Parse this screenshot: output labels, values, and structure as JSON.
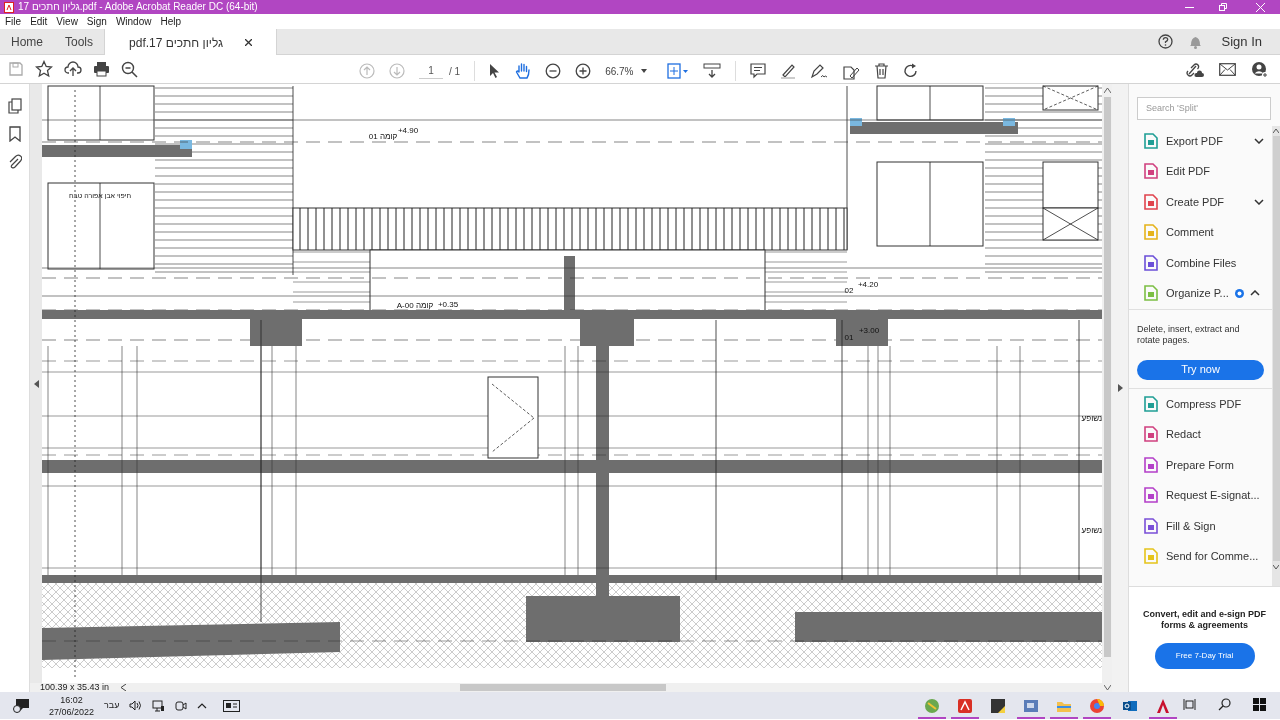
{
  "title_bar": {
    "title": "גליון חתכים 17.pdf - Adobe Acrobat Reader DC (64-bit)"
  },
  "menu": [
    "File",
    "Edit",
    "View",
    "Sign",
    "Window",
    "Help"
  ],
  "tabs": [
    {
      "label": "Home",
      "selected": false
    },
    {
      "label": "Tools",
      "selected": false
    },
    {
      "label": "גליון חתכים 17.pdf",
      "selected": true,
      "closable": true
    }
  ],
  "account": {
    "sign_in": "Sign In"
  },
  "toolbar": {
    "page": "1",
    "page_total": "/ 1",
    "zoom": "66.7%"
  },
  "drawing_labels": [
    {
      "text": "+4.90"
    },
    {
      "text": "קומה 01"
    },
    {
      "text": "+0.35"
    },
    {
      "text": "קומה 00-A"
    },
    {
      "text": "+4.20"
    },
    {
      "text": "02"
    },
    {
      "text": "+3.00"
    },
    {
      "text": "01"
    },
    {
      "text": "נשופע"
    },
    {
      "text": "נשופע"
    },
    {
      "text": "חיפוי אבן אפורה טבח"
    }
  ],
  "status": {
    "page_size": "100.39 x 35.43 in"
  },
  "tools_pane": {
    "search": {
      "placeholder": "Search 'Split'"
    },
    "items": [
      {
        "label": "Export PDF",
        "color": "#1f9e95",
        "kind": "expandable",
        "expanded": false
      },
      {
        "label": "Edit PDF",
        "color": "#d0407f",
        "kind": "plain"
      },
      {
        "label": "Create PDF",
        "color": "#e0434d",
        "kind": "expandable",
        "expanded": false
      },
      {
        "label": "Comment",
        "color": "#e5b31b",
        "kind": "plain"
      },
      {
        "label": "Combine Files",
        "color": "#6b4fd8",
        "kind": "plain"
      },
      {
        "label": "Organize P...",
        "color": "#7cbf44",
        "kind": "expandable",
        "expanded": true,
        "badge": true,
        "description": "Delete, insert, extract and rotate pages.",
        "action": "Try now"
      },
      {
        "label": "Compress PDF",
        "color": "#1f9e95",
        "kind": "plain"
      },
      {
        "label": "Redact",
        "color": "#d0407f",
        "kind": "plain"
      },
      {
        "label": "Prepare Form",
        "color": "#b43fc9",
        "kind": "plain"
      },
      {
        "label": "Request E-signat...",
        "color": "#b43fc9",
        "kind": "plain"
      },
      {
        "label": "Fill & Sign",
        "color": "#7a4fd8",
        "kind": "plain"
      },
      {
        "label": "Send for Comme...",
        "color": "#e5c41b",
        "kind": "plain"
      }
    ],
    "promo": {
      "text": "Convert, edit and e-sign PDF forms & agreements",
      "button": "Free 7-Day Trial"
    }
  },
  "taskbar": {
    "time": "16:02",
    "date": "27/06/2022",
    "language": "עבר",
    "apps": [
      {
        "running": true
      },
      {
        "running": true
      },
      {
        "running": false
      },
      {
        "running": true
      },
      {
        "running": true
      },
      {
        "running": true
      },
      {
        "running": false
      },
      {
        "running": true
      }
    ]
  }
}
